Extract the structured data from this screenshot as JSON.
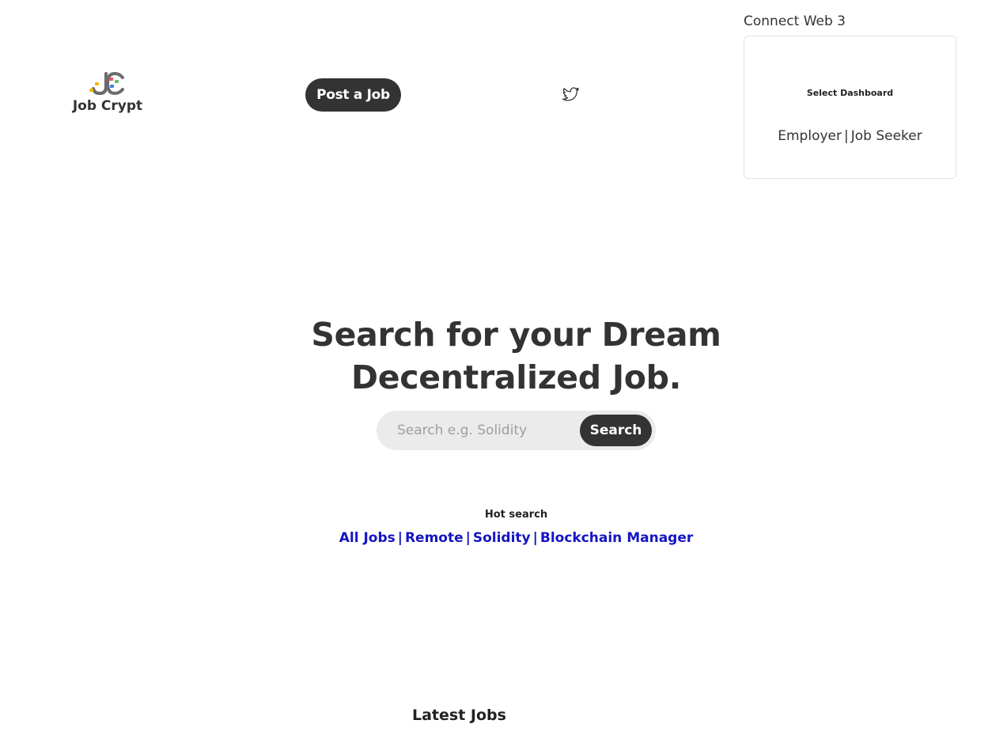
{
  "header": {
    "logo_text": "Job Crypt",
    "post_job_label": "Post a Job",
    "social_icon": "twitter-icon"
  },
  "connect": {
    "title": "Connect Web 3",
    "dashboard_heading": "Select Dashboard",
    "employer_label": "Employer",
    "job_seeker_label": "Job Seeker",
    "separator": "|"
  },
  "hero": {
    "title_line1": "Search for your Dream",
    "title_line2": "Decentralized Job."
  },
  "search": {
    "placeholder": "Search e.g. Solidity",
    "value": "",
    "button_label": "Search"
  },
  "hot_search": {
    "label": "Hot search",
    "links": [
      "All Jobs",
      "Remote",
      "Solidity",
      "Blockchain Manager"
    ],
    "separator": "|"
  },
  "latest": {
    "title": "Latest Jobs"
  },
  "colors": {
    "primary_dark": "#333333",
    "link_blue": "#1515c4",
    "search_bg": "#ebebeb",
    "logo_gray": "#6b6b6b",
    "logo_yellow": "#f2b705",
    "logo_red": "#e8545f",
    "logo_green": "#5cc26b",
    "logo_blue": "#3f7fe0"
  }
}
